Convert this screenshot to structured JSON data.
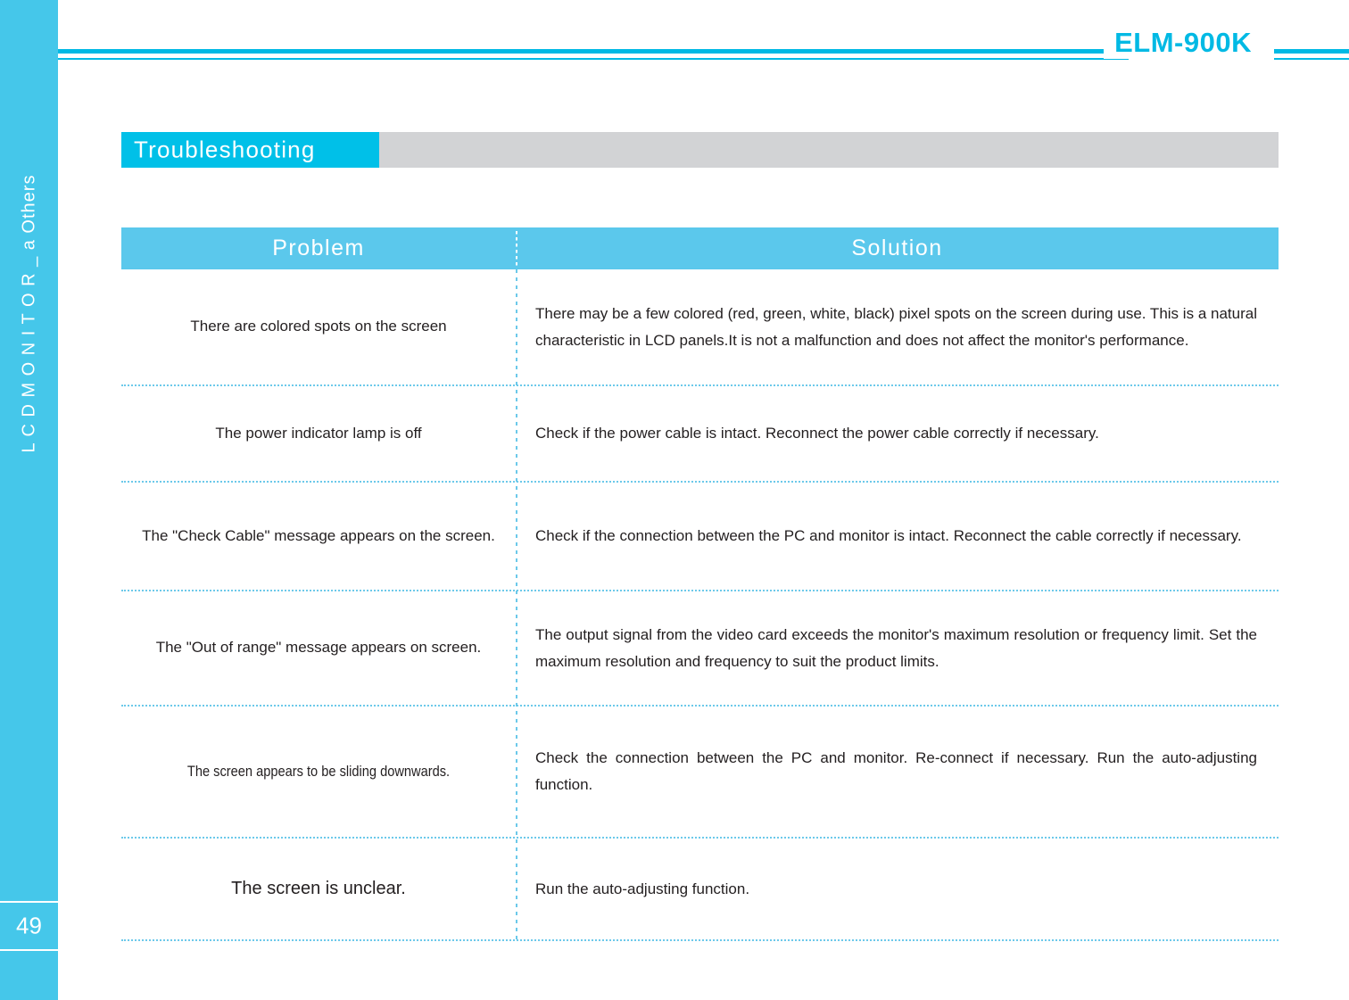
{
  "sidebar": {
    "vertical_label": "L C D  M O N I T O R _ a Others",
    "page_number": "49"
  },
  "header": {
    "model": "ELM-900K"
  },
  "section": {
    "title": "Troubleshooting"
  },
  "table": {
    "columns": [
      "Problem",
      "Solution"
    ],
    "rows": [
      {
        "problem": "There are colored spots on the screen",
        "solution": "There may be a few colored (red, green, white, black) pixel spots on the screen during use. This is a natural characteristic in LCD panels.It is not a malfunction and does not affect the monitor's performance."
      },
      {
        "problem": "The power indicator lamp is off",
        "solution": "Check if the power cable is intact. Reconnect the power cable correctly if necessary."
      },
      {
        "problem": "The \"Check Cable\" message appears on the screen.",
        "solution": "Check if the connection between the PC and monitor is intact. Reconnect the cable correctly if necessary."
      },
      {
        "problem": "The \"Out of range\" message appears on screen.",
        "solution": "The output signal from the video card exceeds the monitor's maximum resolution or frequency limit. Set the maximum resolution and frequency to suit the product limits."
      },
      {
        "problem": "The screen appears to be sliding downwards.",
        "solution": "Check the connection between the PC and monitor. Re-connect if necessary. Run the auto-adjusting function."
      },
      {
        "problem": "The screen is unclear.",
        "solution": "Run the auto-adjusting function."
      }
    ]
  },
  "colors": {
    "sidebar": "#45c7ea",
    "header_rule": "#00b9e4",
    "section_tab": "#00c0e8",
    "section_bar": "#d2d3d5",
    "table_head": "#5bc8ec",
    "dotted_rule": "#6cc9ea",
    "body_text": "#231f20"
  }
}
